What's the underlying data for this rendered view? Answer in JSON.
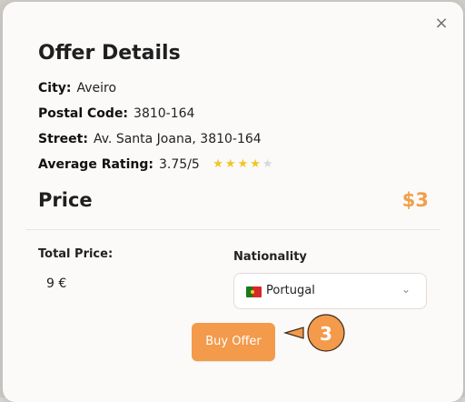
{
  "modal": {
    "title": "Offer Details",
    "close_icon": "×",
    "city_label": "City:",
    "city_value": "Aveiro",
    "postal_label": "Postal Code:",
    "postal_value": "3810-164",
    "street_label": "Street:",
    "street_value": "Av. Santa Joana, 3810-164",
    "rating_label": "Average Rating:",
    "rating_value": "3.75/5",
    "price_label": "Price",
    "price_value": "$3",
    "total_label": "Total Price:",
    "total_value": "9 €",
    "nationality_label": "Nationality",
    "nationality_value": "Portugal",
    "buy_label": "Buy Offer"
  },
  "callout": {
    "number": "3"
  }
}
